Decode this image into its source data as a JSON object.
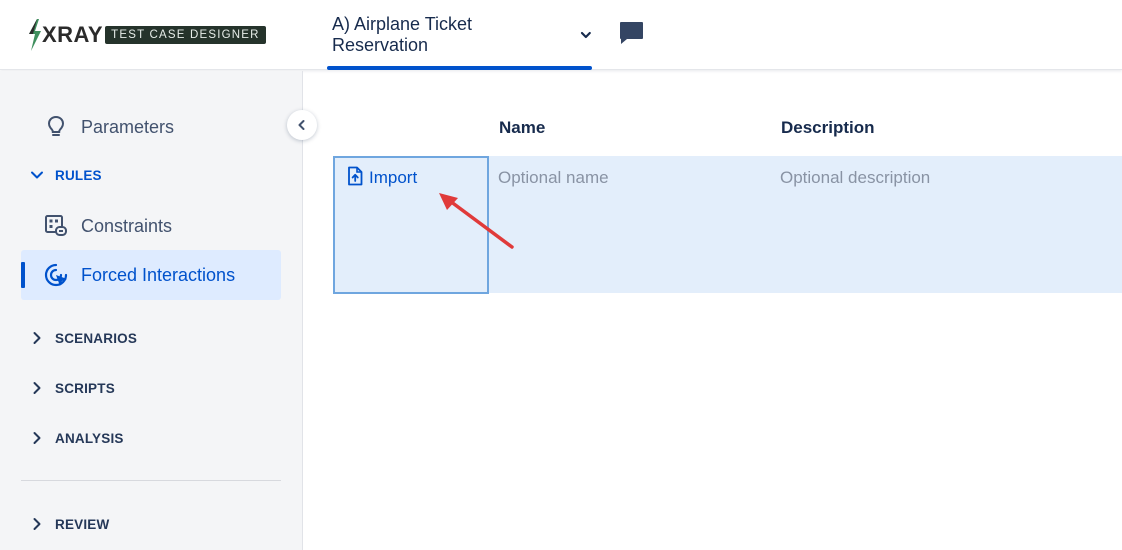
{
  "header": {
    "logo": {
      "brand": "XRAY",
      "badge": "TEST CASE DESIGNER"
    },
    "project_tab": {
      "label": "A) Airplane Ticket Reservation",
      "icon": "chevron-down-icon"
    },
    "comment_icon": "comment-icon",
    "accent_color": "#0052cc"
  },
  "sidebar": {
    "items": [
      {
        "label": "Parameters",
        "icon": "lightbulb-icon"
      },
      {
        "label": "Constraints",
        "icon": "constraints-icon"
      },
      {
        "label": "Forced Interactions",
        "icon": "target-cursor-icon",
        "active": true
      }
    ],
    "sections": [
      {
        "label": "RULES",
        "expanded": true
      },
      {
        "label": "SCENARIOS",
        "expanded": false
      },
      {
        "label": "SCRIPTS",
        "expanded": false
      },
      {
        "label": "ANALYSIS",
        "expanded": false
      },
      {
        "label": "REVIEW",
        "expanded": false
      }
    ],
    "collapse_icon": "chevron-left-icon"
  },
  "table": {
    "columns": [
      "Name",
      "Description"
    ],
    "row": {
      "import_label": "Import",
      "import_icon": "file-upload-icon",
      "name_placeholder": "Optional name",
      "description_placeholder": "Optional description"
    }
  },
  "colors": {
    "row_highlight": "#e3eefb",
    "selected_cell_border": "#6fa6df",
    "annotation_arrow": "#e03a3a"
  }
}
